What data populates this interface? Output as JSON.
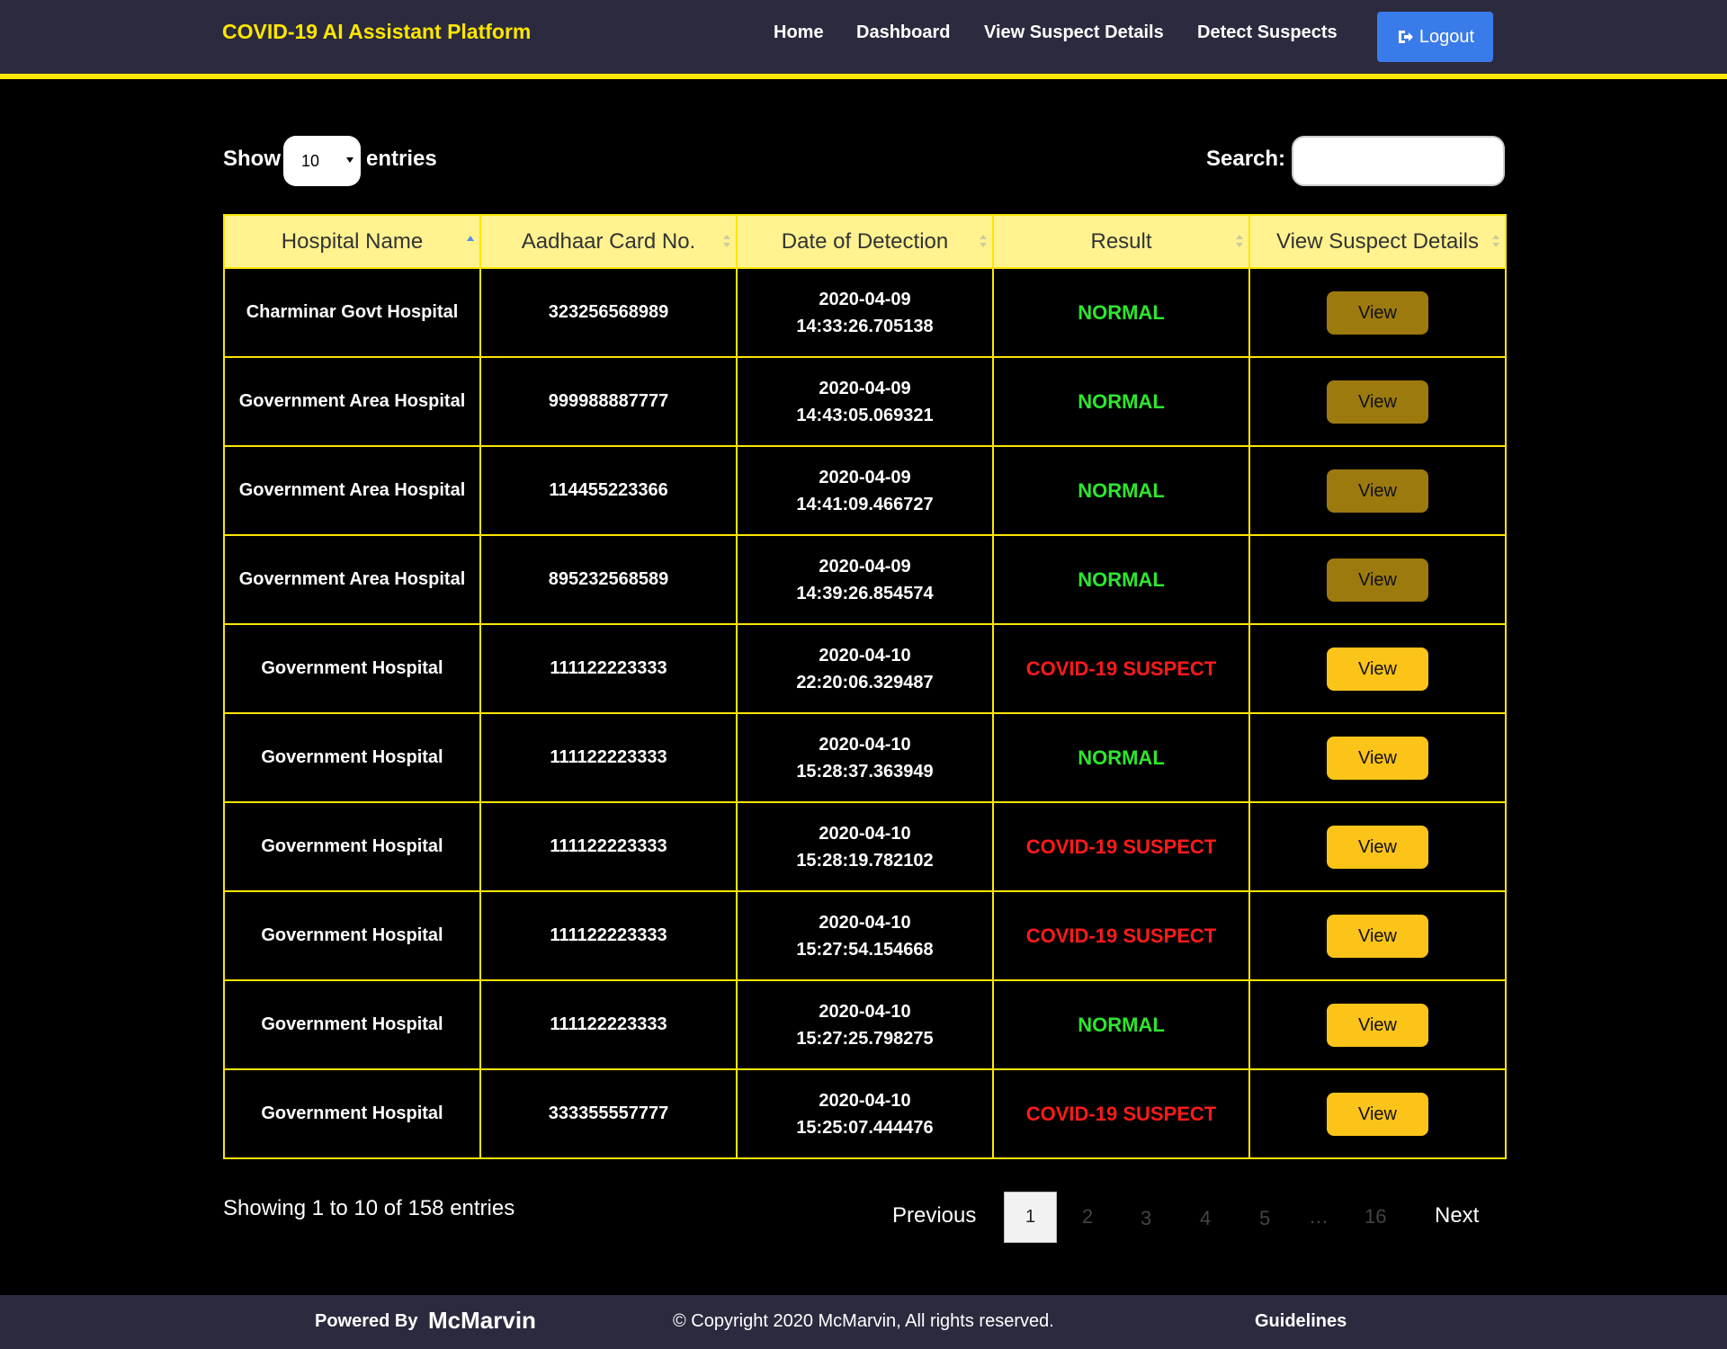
{
  "nav": {
    "brand": "COVID-19 AI Assistant Platform",
    "links": [
      "Home",
      "Dashboard",
      "View Suspect Details",
      "Detect Suspects"
    ],
    "logout": "Logout"
  },
  "controls": {
    "show_label": "Show",
    "entries_value": "10",
    "entries_label": "entries",
    "search_label": "Search:",
    "search_value": ""
  },
  "table": {
    "headers": [
      "Hospital Name",
      "Aadhaar Card No.",
      "Date of Detection",
      "Result",
      "View Suspect Details"
    ],
    "rows": [
      {
        "hospital": "Charminar Govt Hospital",
        "aadhaar": "323256568989",
        "date": "2020-04-09",
        "time": "14:33:26.705138",
        "result": "NORMAL",
        "view": "View"
      },
      {
        "hospital": "Government Area Hospital",
        "aadhaar": "999988887777",
        "date": "2020-04-09",
        "time": "14:43:05.069321",
        "result": "NORMAL",
        "view": "View"
      },
      {
        "hospital": "Government Area Hospital",
        "aadhaar": "114455223366",
        "date": "2020-04-09",
        "time": "14:41:09.466727",
        "result": "NORMAL",
        "view": "View"
      },
      {
        "hospital": "Government Area Hospital",
        "aadhaar": "895232568589",
        "date": "2020-04-09",
        "time": "14:39:26.854574",
        "result": "NORMAL",
        "view": "View"
      },
      {
        "hospital": "Government Hospital",
        "aadhaar": "111122223333",
        "date": "2020-04-10",
        "time": "22:20:06.329487",
        "result": "COVID-19 SUSPECT",
        "view": "View"
      },
      {
        "hospital": "Government Hospital",
        "aadhaar": "111122223333",
        "date": "2020-04-10",
        "time": "15:28:37.363949",
        "result": "NORMAL",
        "view": "View"
      },
      {
        "hospital": "Government Hospital",
        "aadhaar": "111122223333",
        "date": "2020-04-10",
        "time": "15:28:19.782102",
        "result": "COVID-19 SUSPECT",
        "view": "View"
      },
      {
        "hospital": "Government Hospital",
        "aadhaar": "111122223333",
        "date": "2020-04-10",
        "time": "15:27:54.154668",
        "result": "COVID-19 SUSPECT",
        "view": "View"
      },
      {
        "hospital": "Government Hospital",
        "aadhaar": "111122223333",
        "date": "2020-04-10",
        "time": "15:27:25.798275",
        "result": "NORMAL",
        "view": "View"
      },
      {
        "hospital": "Government Hospital",
        "aadhaar": "333355557777",
        "date": "2020-04-10",
        "time": "15:25:07.444476",
        "result": "COVID-19 SUSPECT",
        "view": "View"
      }
    ]
  },
  "pagination": {
    "info": "Showing 1 to 10 of 158 entries",
    "previous": "Previous",
    "current": "1",
    "pages": [
      "2",
      "3",
      "4",
      "5",
      "…",
      "16"
    ],
    "next": "Next"
  },
  "footer": {
    "powered_by": "Powered By",
    "brand": "McMarvin",
    "copyright": "© Copyright 2020 McMarvin, All rights reserved.",
    "guidelines": "Guidelines"
  },
  "colors": {
    "accent_yellow": "#fde600",
    "header_bg": "#fff28f",
    "normal": "#2ee62e",
    "suspect": "#ff1a1a",
    "logout": "#3a7bea"
  }
}
